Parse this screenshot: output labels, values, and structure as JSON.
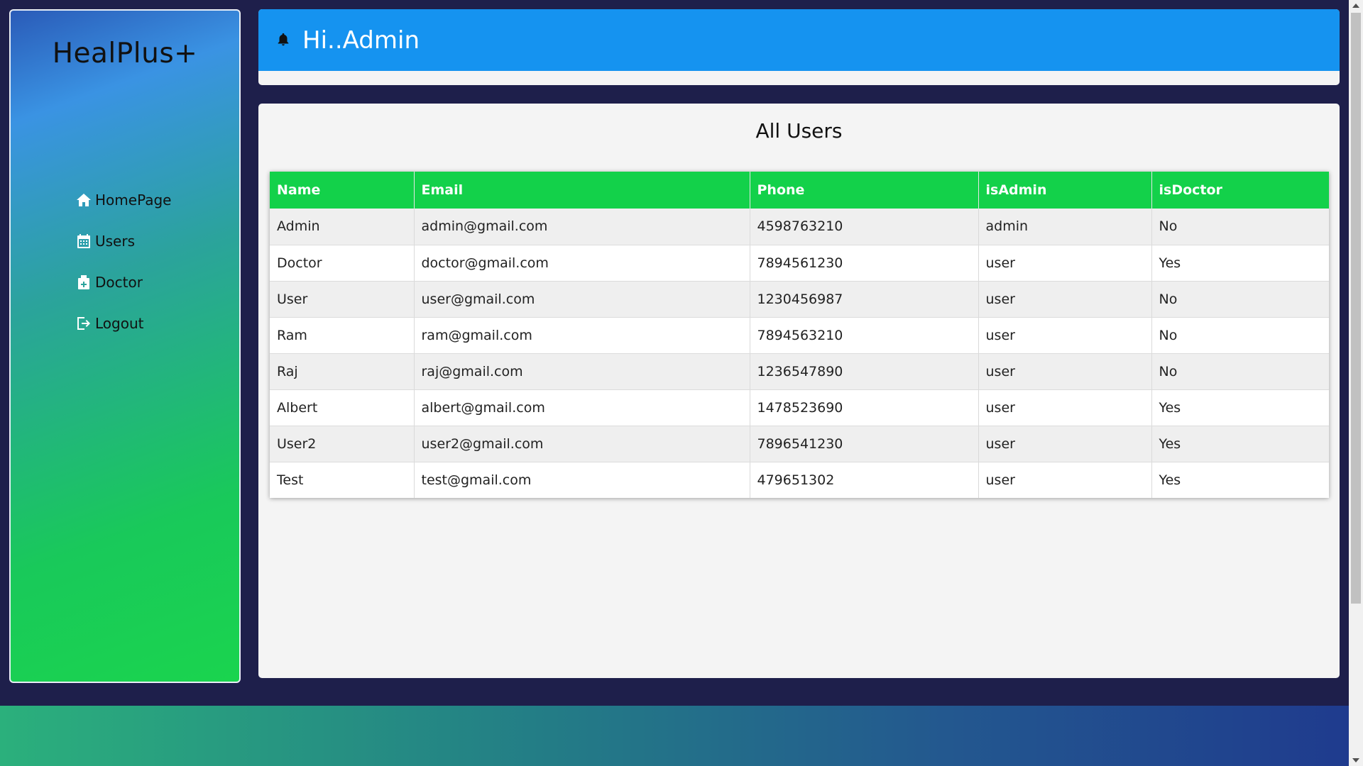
{
  "sidebar": {
    "brand": "HealPlus+",
    "items": [
      {
        "label": "HomePage",
        "icon": "home-icon"
      },
      {
        "label": "Users",
        "icon": "calendar-icon"
      },
      {
        "label": "Doctor",
        "icon": "medical-kit-icon"
      },
      {
        "label": "Logout",
        "icon": "logout-icon"
      }
    ]
  },
  "header": {
    "icon": "bell-icon",
    "greeting": "Hi..Admin"
  },
  "main": {
    "title": "All Users",
    "table": {
      "columns": [
        "Name",
        "Email",
        "Phone",
        "isAdmin",
        "isDoctor"
      ],
      "rows": [
        [
          "Admin",
          "admin@gmail.com",
          "4598763210",
          "admin",
          "No"
        ],
        [
          "Doctor",
          "doctor@gmail.com",
          "7894561230",
          "user",
          "Yes"
        ],
        [
          "User",
          "user@gmail.com",
          "1230456987",
          "user",
          "No"
        ],
        [
          "Ram",
          "ram@gmail.com",
          "7894563210",
          "user",
          "No"
        ],
        [
          "Raj",
          "raj@gmail.com",
          "1236547890",
          "user",
          "No"
        ],
        [
          "Albert",
          "albert@gmail.com",
          "1478523690",
          "user",
          "Yes"
        ],
        [
          "User2",
          "user2@gmail.com",
          "7896541230",
          "user",
          "Yes"
        ],
        [
          "Test",
          "test@gmail.com",
          "479651302",
          "user",
          "Yes"
        ]
      ]
    }
  },
  "colors": {
    "header_bar": "#1593f0",
    "table_header": "#13d14a",
    "page_background": "#1e1f4b"
  }
}
